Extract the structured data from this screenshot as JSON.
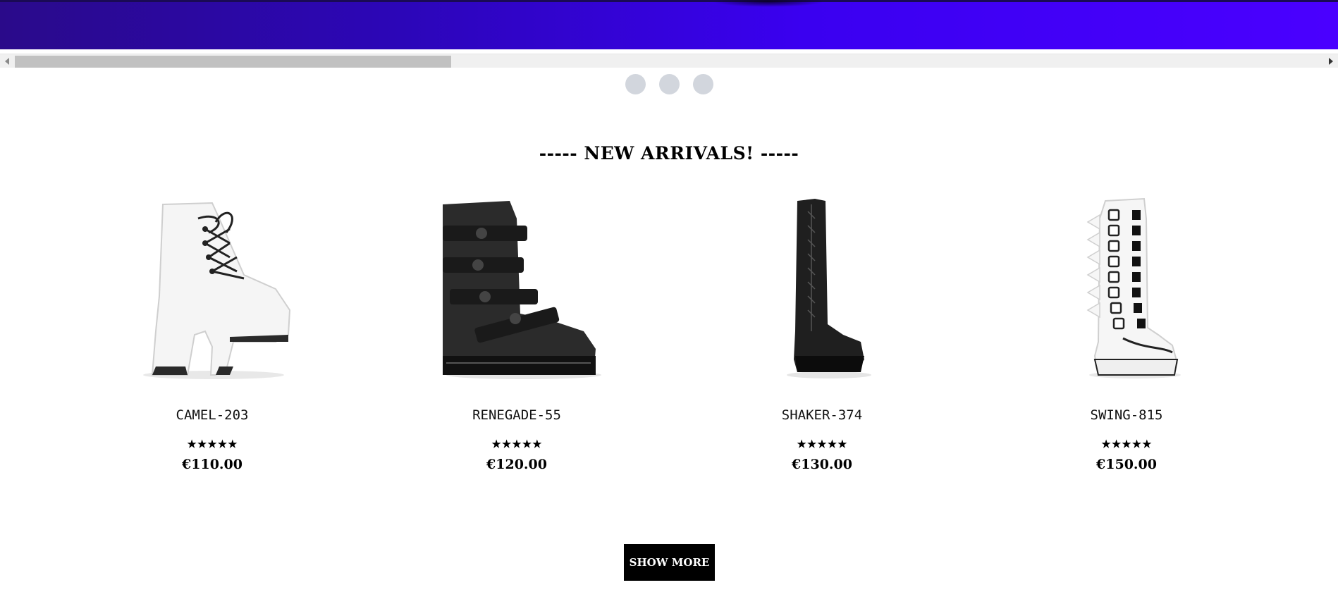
{
  "hero": {
    "colors": {
      "start": "#2a0a8a",
      "end": "#4a00ff"
    }
  },
  "carousel": {
    "dot_count": 3,
    "dot_color": "#d2d6dd"
  },
  "section": {
    "title": "----- NEW ARRIVALS! -----"
  },
  "products": [
    {
      "name": "CAMEL-203",
      "rating": "★★★★★",
      "rating_value": 5,
      "price": "€110.00",
      "image_icon": "white-platform-ankle-boot"
    },
    {
      "name": "RENEGADE-55",
      "rating": "★★★★★",
      "rating_value": 5,
      "price": "€120.00",
      "image_icon": "black-strap-combat-boot"
    },
    {
      "name": "SHAKER-374",
      "rating": "★★★★★",
      "rating_value": 5,
      "price": "€130.00",
      "image_icon": "black-thigh-high-lace-boot"
    },
    {
      "name": "SWING-815",
      "rating": "★★★★★",
      "rating_value": 5,
      "price": "€150.00",
      "image_icon": "white-buckle-platform-boot"
    }
  ],
  "actions": {
    "show_more_label": "SHOW MORE"
  }
}
